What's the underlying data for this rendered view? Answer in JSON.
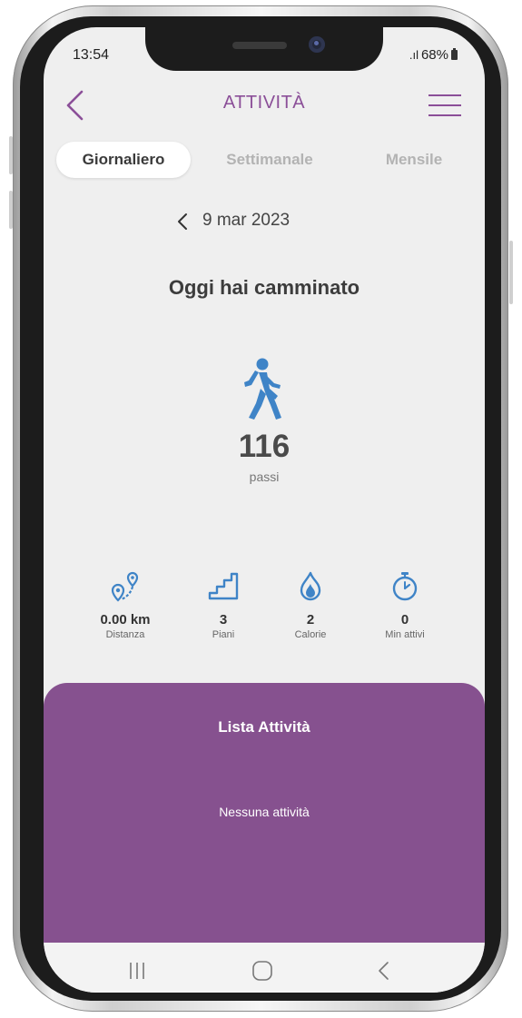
{
  "status_bar": {
    "time": "13:54",
    "battery": "68%"
  },
  "header": {
    "title": "ATTIVITÀ"
  },
  "tabs": [
    {
      "label": "Giornaliero",
      "active": true
    },
    {
      "label": "Settimanale",
      "active": false
    },
    {
      "label": "Mensile",
      "active": false
    }
  ],
  "date": {
    "label": "9 mar 2023"
  },
  "summary": {
    "headline": "Oggi hai camminato",
    "steps": "116",
    "steps_unit": "passi"
  },
  "stats": [
    {
      "value": "0.00 km",
      "label": "Distanza",
      "icon": "distance-icon"
    },
    {
      "value": "3",
      "label": "Piani",
      "icon": "stairs-icon"
    },
    {
      "value": "2",
      "label": "Calorie",
      "icon": "flame-icon"
    },
    {
      "value": "0",
      "label": "Min attivi",
      "icon": "stopwatch-icon"
    }
  ],
  "activity_list": {
    "title": "Lista Attività",
    "empty": "Nessuna attività"
  },
  "colors": {
    "accent": "#8b4f98",
    "panel": "#86518f",
    "icon_blue": "#3f84c7",
    "background": "#efefef"
  }
}
